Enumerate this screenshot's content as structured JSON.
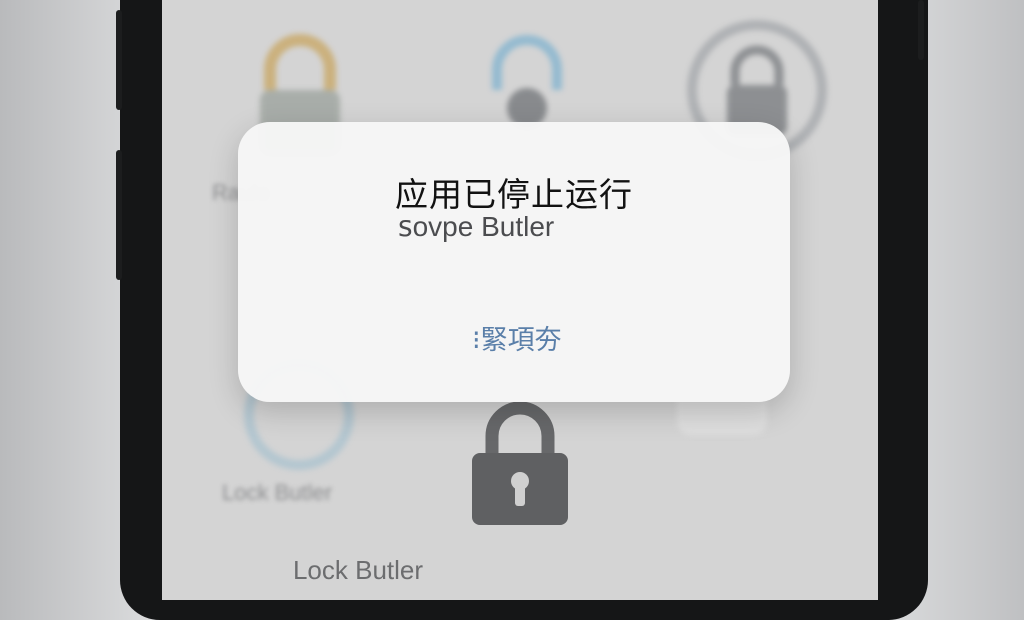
{
  "dialog": {
    "title": "应用已停止运行",
    "message": "ꜱovpe Butler",
    "button_label": "⁝緊項夯"
  },
  "home_screen": {
    "app_label": "Lock Butler",
    "blurred_label": "Lock Butler"
  },
  "icons": [
    "lock-icon",
    "padlock-icon"
  ],
  "colors": {
    "dialog_bg": "#f6f6f6",
    "button_text": "#5a7fa9",
    "phone_frame": "#151617"
  }
}
